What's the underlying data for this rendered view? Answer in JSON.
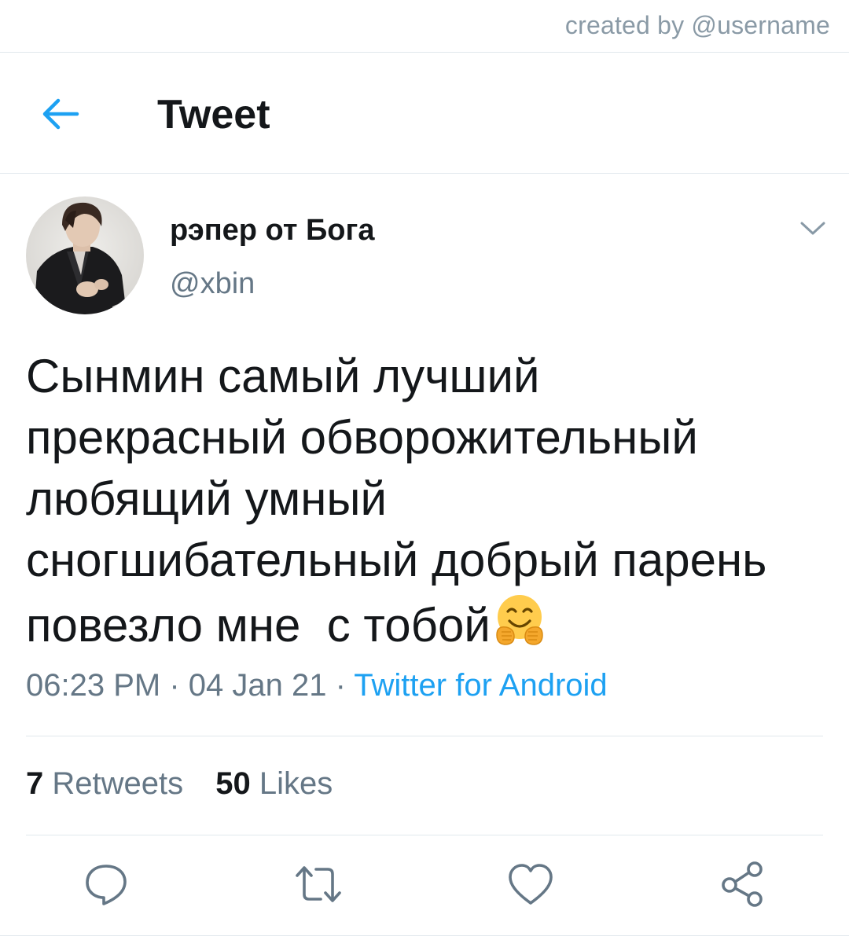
{
  "watermark": "created by @username",
  "header": {
    "title": "Tweet",
    "back_icon": "arrow-left-icon"
  },
  "tweet": {
    "display_name": "рэпер от Бога",
    "handle": "@xbin",
    "text_lines": [
      "Сынмин самый лучший",
      "прекрасный обворожительный",
      "любящий умный",
      "сногшибательный добрый парень",
      "повезло мне  с тобой"
    ],
    "emoji": "hugging-face-emoji",
    "time": "06:23 PM",
    "date": "04 Jan 21",
    "source": "Twitter for Android",
    "separator": " · ",
    "retweets_count": "7",
    "retweets_label": "Retweets",
    "likes_count": "50",
    "likes_label": "Likes"
  },
  "actions": [
    "reply-icon",
    "retweet-icon",
    "like-icon",
    "share-icon"
  ],
  "colors": {
    "accent": "#1da1f2",
    "text_primary": "#14171a",
    "text_secondary": "#657786",
    "divider": "#e1e8ed",
    "watermark": "#8a9aa6"
  }
}
